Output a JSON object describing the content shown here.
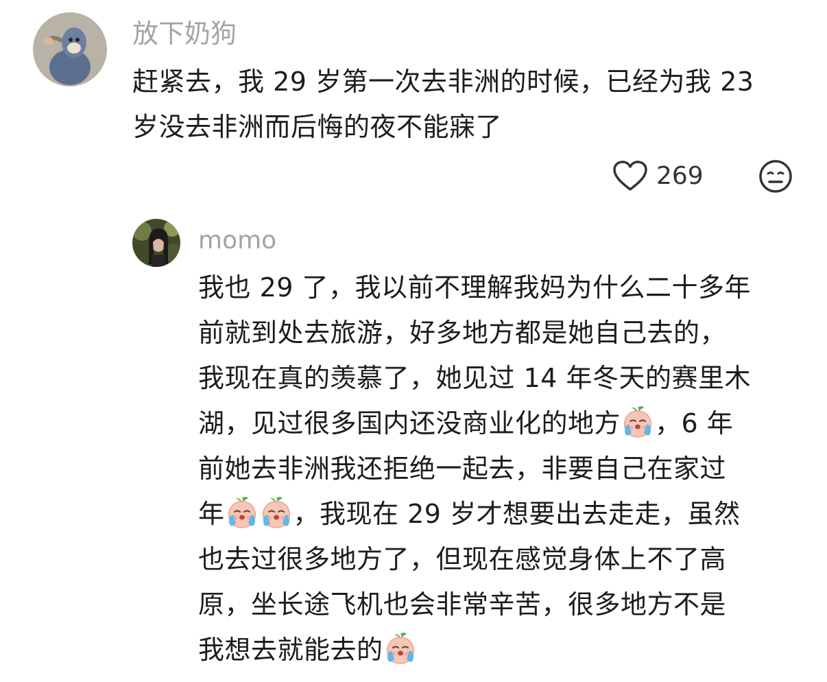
{
  "comment": {
    "username": "放下奶狗",
    "text_lines": [
      "赶紧去，我 29 岁第一次去非洲的时候，已经为我 23",
      "岁没去非洲而后悔的夜不能寐了"
    ],
    "like_count": "269",
    "like_icon": "heart-outline-icon",
    "reaction_icon": "neutral-face-icon"
  },
  "reply": {
    "username": "momo",
    "line1": "我也 29 了，我以前不理解我妈为什么二十多年",
    "line2": "前就到处去旅游，好多地方都是她自己去的，",
    "line3": "我现在真的羡慕了，她见过 14 年冬天的赛里木",
    "line4_a": "湖，见过很多国内还没商业化的地方",
    "line4_b": "，6 年",
    "line5": "前她去非洲我还拒绝一起去，非要自己在家过",
    "line6_a": "年",
    "line6_b": "，我现在 29 岁才想要出去走走，虽然",
    "line7": "也去过很多地方了，但现在感觉身体上不了高",
    "line8": "原，坐长途飞机也会非常辛苦，很多地方不是",
    "line9_a": "我想去就能去的",
    "emoji_name": "crying-peach-emoji"
  },
  "colors": {
    "username": "#a3a3a3",
    "text": "#1c1c1c",
    "icon": "#333333"
  }
}
